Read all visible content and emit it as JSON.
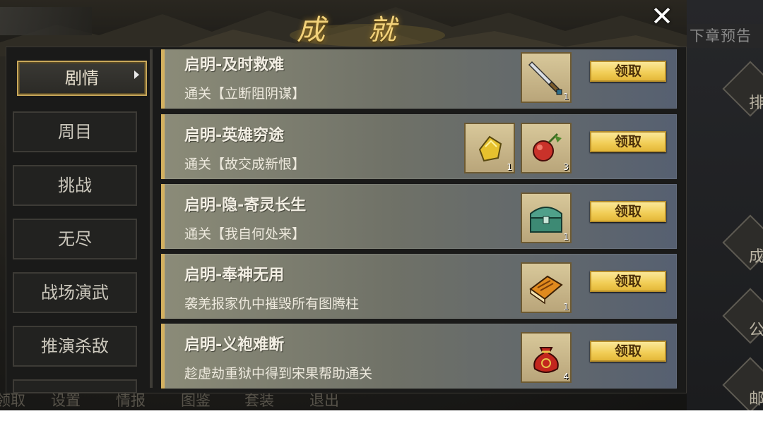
{
  "header": {
    "title": "成 就",
    "close_symbol": "✕"
  },
  "right_panel": {
    "next_chapter": "下章预告",
    "buttons": [
      {
        "label": "排行",
        "icon": "leaderboard-icon"
      },
      {
        "label": "成就",
        "icon": "achievement-icon"
      },
      {
        "label": "公告",
        "icon": "announcement-icon"
      },
      {
        "label": "邮件",
        "icon": "mail-icon"
      }
    ]
  },
  "bottom_menu": [
    "领取",
    "设置",
    "情报",
    "图鉴",
    "套装",
    "退出"
  ],
  "nav": {
    "items": [
      {
        "label": "剧情",
        "active": true
      },
      {
        "label": "周目",
        "active": false
      },
      {
        "label": "挑战",
        "active": false
      },
      {
        "label": "无尽",
        "active": false
      },
      {
        "label": "战场演武",
        "active": false
      },
      {
        "label": "推演杀敌",
        "active": false
      }
    ]
  },
  "achievements": [
    {
      "title": "启明-及时救难",
      "desc": "通关【立断阻阴谋】",
      "rewards": [
        {
          "icon": "sword-icon",
          "count": "1"
        }
      ],
      "button": "领取"
    },
    {
      "title": "启明-英雄穷途",
      "desc": "通关【故交成新恨】",
      "rewards": [
        {
          "icon": "gold-gem-icon",
          "count": "1"
        },
        {
          "icon": "red-fruit-icon",
          "count": "3"
        }
      ],
      "button": "领取"
    },
    {
      "title": "启明-隐-寄灵长生",
      "desc": "通关【我自何处来】",
      "rewards": [
        {
          "icon": "jade-chest-icon",
          "count": "1"
        }
      ],
      "button": "领取"
    },
    {
      "title": "启明-奉神无用",
      "desc": "袭羌报家仇中摧毁所有图腾柱",
      "rewards": [
        {
          "icon": "book-icon",
          "count": "1"
        }
      ],
      "button": "领取"
    },
    {
      "title": "启明-义袍难断",
      "desc": "趁虚劫重狱中得到宋果帮助通关",
      "rewards": [
        {
          "icon": "red-pouch-icon",
          "count": "4"
        }
      ],
      "button": "领取"
    }
  ]
}
